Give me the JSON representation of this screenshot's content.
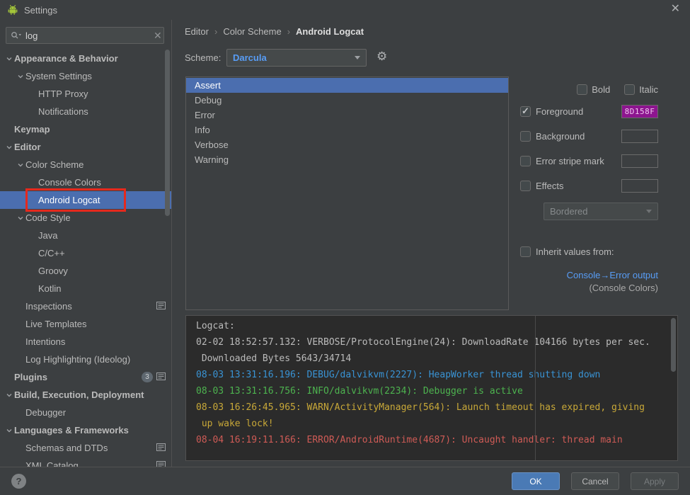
{
  "window": {
    "title": "Settings",
    "close_glyph": "✕"
  },
  "colors": {
    "selection": "#4b6eaf",
    "link": "#589df6",
    "annotation": "#e5291d",
    "ok": "#4a7ab5"
  },
  "sidebar": {
    "search": {
      "value": "log",
      "clear_glyph": "✕"
    },
    "items": [
      {
        "label": "Appearance & Behavior",
        "level": 0,
        "bold": true,
        "chevron": true
      },
      {
        "label": "System Settings",
        "level": 1,
        "chevron": true
      },
      {
        "label": "HTTP Proxy",
        "level": 2
      },
      {
        "label": "Notifications",
        "level": 2
      },
      {
        "label": "Keymap",
        "level": 0,
        "bold": true
      },
      {
        "label": "Editor",
        "level": 0,
        "bold": true,
        "chevron": true
      },
      {
        "label": "Color Scheme",
        "level": 1,
        "chevron": true
      },
      {
        "label": "Console Colors",
        "level": 2
      },
      {
        "label": "Android Logcat",
        "level": 2,
        "selected": true
      },
      {
        "label": "Code Style",
        "level": 1,
        "chevron": true
      },
      {
        "label": "Java",
        "level": 2
      },
      {
        "label": "C/C++",
        "level": 2
      },
      {
        "label": "Groovy",
        "level": 2
      },
      {
        "label": "Kotlin",
        "level": 2
      },
      {
        "label": "Inspections",
        "level": 1,
        "page_icon": true
      },
      {
        "label": "Live Templates",
        "level": 1
      },
      {
        "label": "Intentions",
        "level": 1
      },
      {
        "label": "Log Highlighting (Ideolog)",
        "level": 1
      },
      {
        "label": "Plugins",
        "level": 0,
        "bold": true,
        "badge": "3",
        "page_icon": true
      },
      {
        "label": "Build, Execution, Deployment",
        "level": 0,
        "bold": true,
        "chevron": true
      },
      {
        "label": "Debugger",
        "level": 1
      },
      {
        "label": "Languages & Frameworks",
        "level": 0,
        "bold": true,
        "chevron": true
      },
      {
        "label": "Schemas and DTDs",
        "level": 1,
        "page_icon": true
      },
      {
        "label": "XML Catalog",
        "level": 1,
        "page_icon": true
      }
    ]
  },
  "breadcrumb": {
    "items": [
      "Editor",
      "Color Scheme",
      "Android Logcat"
    ],
    "separator": "›"
  },
  "scheme": {
    "label": "Scheme:",
    "value": "Darcula"
  },
  "token_list": {
    "selected": "Assert",
    "items": [
      "Assert",
      "Debug",
      "Error",
      "Info",
      "Verbose",
      "Warning"
    ]
  },
  "attributes": {
    "bold_label": "Bold",
    "italic_label": "Italic",
    "foreground": {
      "label": "Foreground",
      "checked": true,
      "value": "8D158F",
      "color": "#8D158F"
    },
    "background": {
      "label": "Background",
      "checked": false
    },
    "error_stripe": {
      "label": "Error stripe mark",
      "checked": false
    },
    "effects": {
      "label": "Effects",
      "checked": false
    },
    "effects_style": "Bordered",
    "inherit_label": "Inherit values from:",
    "inherit_link": "Console→Error output",
    "inherit_sub": "(Console Colors)"
  },
  "preview": {
    "colors": {
      "default": "#bbbbbb",
      "verbose": "#bbbbbb",
      "debug": "#3993d4",
      "info": "#4db34f",
      "warn": "#c8a838",
      "error": "#cf5b56"
    },
    "lines": [
      {
        "level": "default",
        "text": "Logcat:"
      },
      {
        "level": "verbose",
        "text": "02-02 18:52:57.132: VERBOSE/ProtocolEngine(24): DownloadRate 104166 bytes per sec."
      },
      {
        "level": "verbose",
        "text": " Downloaded Bytes 5643/34714"
      },
      {
        "level": "debug",
        "text": "08-03 13:31:16.196: DEBUG/dalvikvm(2227): HeapWorker thread shutting down"
      },
      {
        "level": "info",
        "text": "08-03 13:31:16.756: INFO/dalvikvm(2234): Debugger is active"
      },
      {
        "level": "warn",
        "text": "08-03 16:26:45.965: WARN/ActivityManager(564): Launch timeout has expired, giving"
      },
      {
        "level": "warn",
        "text": " up wake lock!"
      },
      {
        "level": "error",
        "text": "08-04 16:19:11.166: ERROR/AndroidRuntime(4687): Uncaught handler: thread main"
      }
    ]
  },
  "footer": {
    "help": "?",
    "ok": "OK",
    "cancel": "Cancel",
    "apply": "Apply"
  }
}
